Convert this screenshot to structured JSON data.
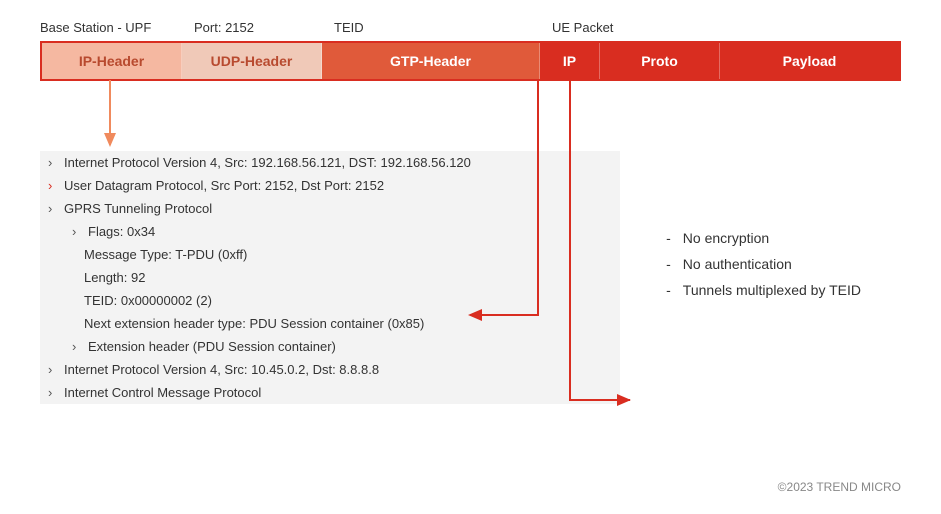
{
  "labels": {
    "base_upf": "Base Station - UPF",
    "port": "Port: 2152",
    "teid": "TEID",
    "ue_packet": "UE Packet"
  },
  "segments": {
    "ip_outer": "IP-Header",
    "udp": "UDP-Header",
    "gtp": "GTP-Header",
    "ip_inner": "IP",
    "proto": "Proto",
    "payload": "Payload"
  },
  "dissect": {
    "ipv4_outer": "Internet Protocol Version 4, Src: 192.168.56.121, DST: 192.168.56.120",
    "udp": "User Datagram Protocol, Src Port: 2152, Dst Port: 2152",
    "gtp": "GPRS Tunneling Protocol",
    "flags": "Flags: 0x34",
    "msg_type": "Message Type: T-PDU (0xff)",
    "length": "Length: 92",
    "teid": "TEID: 0x00000002 (2)",
    "next_ext": "Next extension header type: PDU Session container (0x85)",
    "ext_hdr": "Extension header (PDU Session container)",
    "ipv4_inner": "Internet Protocol Version 4, Src: 10.45.0.2, Dst: 8.8.8.8",
    "icmp": "Internet Control Message Protocol"
  },
  "notes": {
    "a": "No encryption",
    "b": "No authentication",
    "c": "Tunnels multiplexed by TEID"
  },
  "footer": "©2023 TREND MICRO"
}
